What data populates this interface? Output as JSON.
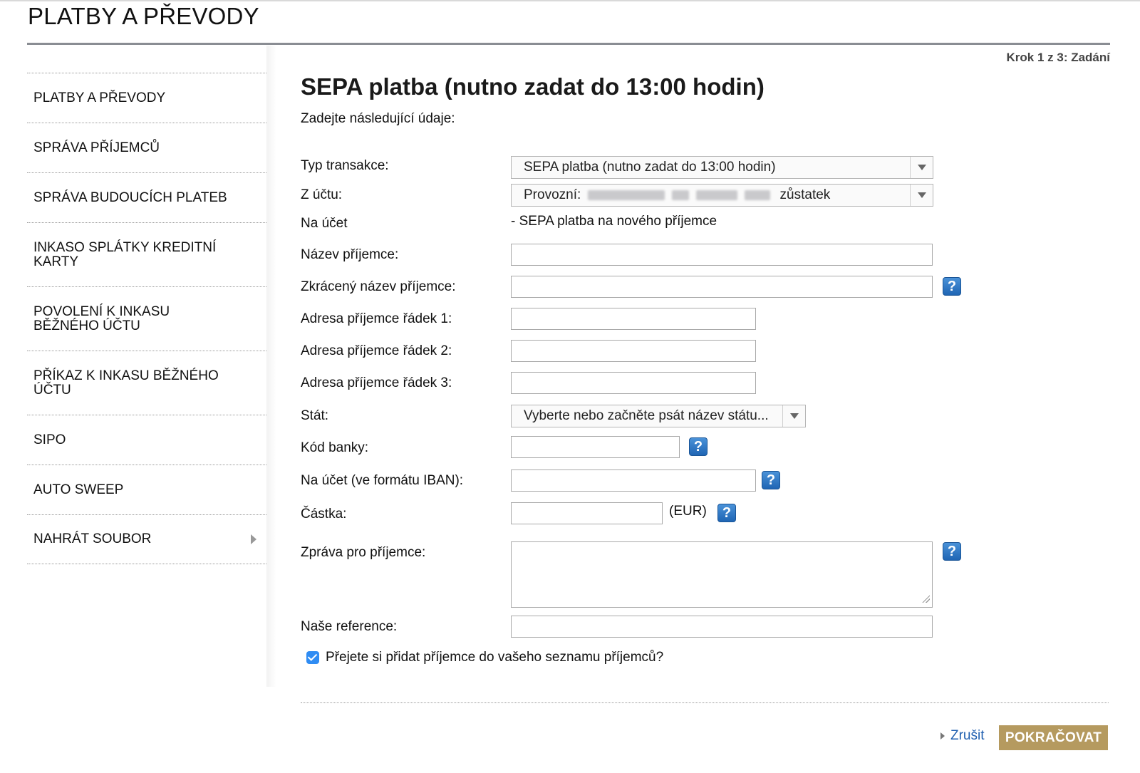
{
  "page": {
    "title": "PLATBY A PŘEVODY",
    "step": "Krok 1 z 3: Zadání"
  },
  "sidebar": {
    "items": [
      {
        "label": "PLATBY A PŘEVODY"
      },
      {
        "label": "SPRÁVA PŘÍJEMCŮ"
      },
      {
        "label": "SPRÁVA BUDOUCÍCH PLATEB"
      },
      {
        "label": "INKASO SPLÁTKY KREDITNÍ KARTY"
      },
      {
        "label": "POVOLENÍ K INKASU BĚŽNÉHO ÚČTU"
      },
      {
        "label": "PŘÍKAZ K INKASU BĚŽNÉHO ÚČTU"
      },
      {
        "label": "SIPO"
      },
      {
        "label": "AUTO SWEEP"
      },
      {
        "label": "NAHRÁT SOUBOR"
      }
    ]
  },
  "form": {
    "heading": "SEPA platba (nutno zadat do 13:00 hodin)",
    "intro": "Zadejte následující údaje:",
    "transaction_type": {
      "label": "Typ transakce:",
      "value": "SEPA platba (nutno zadat do 13:00 hodin)"
    },
    "from_account": {
      "label": "Z účtu:",
      "prefix": "Provozní:",
      "suffix": "zůstatek"
    },
    "to_account": {
      "label": "Na účet",
      "value": "- SEPA platba na nového příjemce"
    },
    "payee_name": {
      "label": "Název příjemce:",
      "value": ""
    },
    "payee_short_name": {
      "label": "Zkrácený název příjemce:",
      "value": ""
    },
    "address1": {
      "label": "Adresa příjemce řádek 1:",
      "value": ""
    },
    "address2": {
      "label": "Adresa příjemce řádek 2:",
      "value": ""
    },
    "address3": {
      "label": "Adresa příjemce řádek 3:",
      "value": ""
    },
    "country": {
      "label": "Stát:",
      "value": "Vyberte nebo začněte psát název státu..."
    },
    "bank_code": {
      "label": "Kód banky:",
      "value": ""
    },
    "iban": {
      "label": "Na účet (ve formátu IBAN):",
      "value": ""
    },
    "amount": {
      "label": "Částka:",
      "value": "",
      "currency": "(EUR)"
    },
    "message": {
      "label": "Zpráva pro příjemce:",
      "value": ""
    },
    "reference": {
      "label": "Naše reference:",
      "value": ""
    },
    "save_payee": {
      "label": "Přejete si přidat příjemce do vašeho seznamu příjemců?",
      "checked": true
    },
    "help_glyph": "?"
  },
  "actions": {
    "cancel": "Zrušit",
    "continue": "POKRAČOVAT"
  },
  "colors": {
    "accent_button": "#b59a5f",
    "link": "#1f5fb0",
    "help_icon": "#1f65b4",
    "checkbox": "#2f8cf3"
  }
}
